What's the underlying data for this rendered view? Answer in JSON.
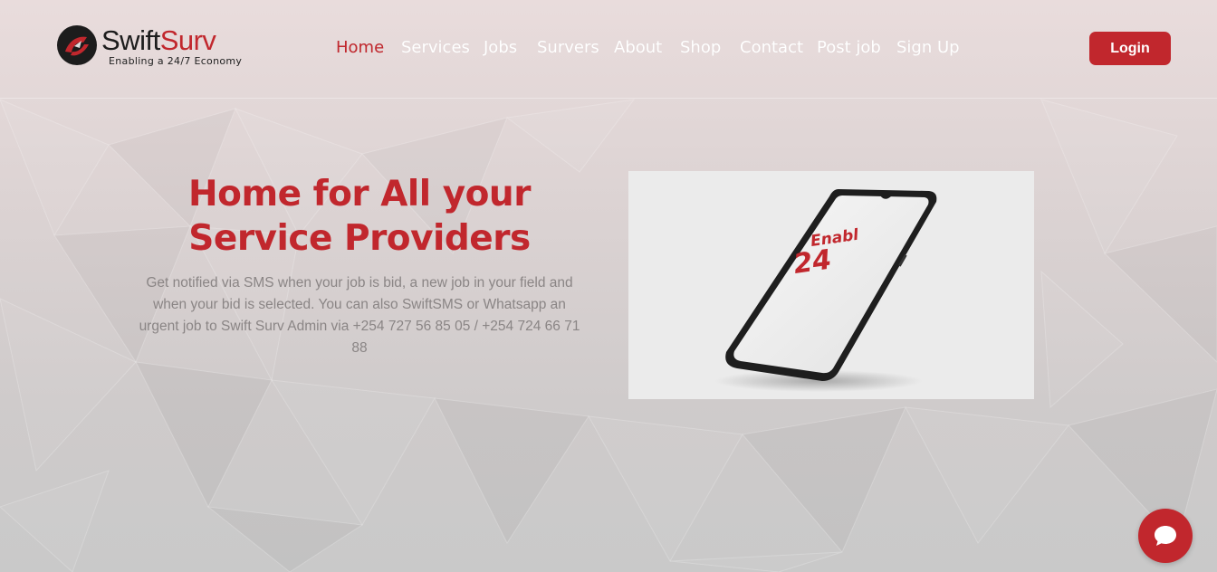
{
  "brand": {
    "name_part1": "Swift",
    "name_part2": "Surv",
    "tagline": "Enabling a 24/7 Economy",
    "colors": {
      "primary": "#c1272d",
      "dark": "#1c1c1c"
    }
  },
  "nav": {
    "items": [
      {
        "label": "Home",
        "active": true
      },
      {
        "label": "Services"
      },
      {
        "label": "Jobs"
      },
      {
        "label": "Survers"
      },
      {
        "label": "About"
      },
      {
        "label": "Shop"
      },
      {
        "label": "Contact"
      },
      {
        "label": "Post job"
      },
      {
        "label": "Sign Up"
      }
    ]
  },
  "header": {
    "login_label": "Login"
  },
  "hero": {
    "title": "Home for All your Service Providers",
    "description": "Get notified via SMS when your job is bid, a new job in your field and when your bid is selected. You can also SwiftSMS or Whatsapp an urgent job to Swift Surv Admin via +254 727 56 85 05 / +254 724 66 71 88",
    "image": {
      "screen_text_line1": "Enabl",
      "screen_text_line2": "24"
    }
  },
  "chat": {
    "icon": "chat-bubble-icon"
  }
}
